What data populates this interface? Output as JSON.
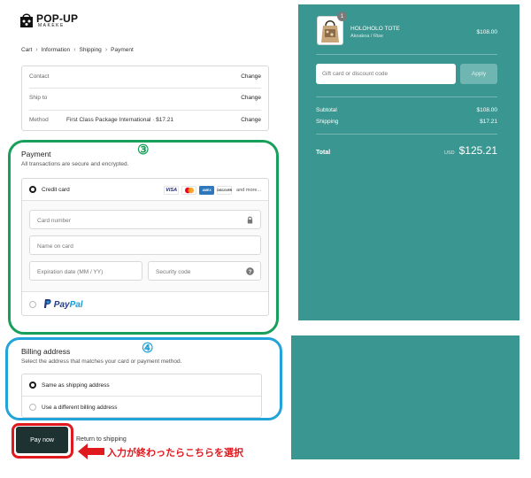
{
  "brand": {
    "name": "POP-UP",
    "sub": "MAKEKE"
  },
  "breadcrumb": [
    "Cart",
    "Information",
    "Shipping",
    "Payment"
  ],
  "info": {
    "rows": [
      {
        "label": "Contact",
        "value": "",
        "action": "Change"
      },
      {
        "label": "Ship to",
        "value": "",
        "action": "Change"
      },
      {
        "label": "Method",
        "value": "First Class Package International · $17.21",
        "action": "Change"
      }
    ]
  },
  "annotations": {
    "payment_number": "③",
    "billing_number": "④",
    "instruction": "入力が終わったらこちらを選択"
  },
  "payment": {
    "title": "Payment",
    "subtitle": "All transactions are secure and encrypted.",
    "credit_card_label": "Credit card",
    "cards": [
      "VISA",
      "AMEX",
      "DISCOVER"
    ],
    "more": "and more...",
    "placeholders": {
      "card_number": "Card number",
      "name_on_card": "Name on card",
      "expiration": "Expiration date (MM / YY)",
      "security": "Security code"
    },
    "paypal": {
      "part1": "Pay",
      "part2": "Pal"
    }
  },
  "billing": {
    "title": "Billing address",
    "subtitle": "Select the address that matches your card or payment method.",
    "options": [
      "Same as shipping address",
      "Use a different billing address"
    ],
    "selected": 0
  },
  "actions": {
    "pay_now": "Pay now",
    "return": "Return to shipping"
  },
  "summary": {
    "product": {
      "name": "HOLOHOLO TOTE",
      "variant": "Akoakoa / Rise",
      "price": "$108.00",
      "quantity": "1"
    },
    "discount_placeholder": "Gift card or discount code",
    "apply": "Apply",
    "subtotal_label": "Subtotal",
    "subtotal": "$108.00",
    "shipping_label": "Shipping",
    "shipping": "$17.21",
    "total_label": "Total",
    "currency": "USD",
    "total": "$125.21"
  },
  "colors": {
    "teal": "#3a9691",
    "green_ring": "#17a05a",
    "blue_ring": "#22a3d9",
    "red_ring": "#e0191e",
    "pay_button": "#1e3232"
  }
}
